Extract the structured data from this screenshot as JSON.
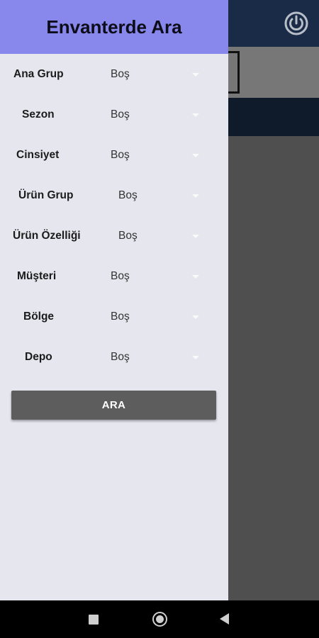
{
  "drawer": {
    "title": "Envanterde Ara",
    "filters": [
      {
        "label": "Ana Grup",
        "value": "Boş"
      },
      {
        "label": "Sezon",
        "value": "Boş"
      },
      {
        "label": "Cinsiyet",
        "value": "Boş"
      },
      {
        "label": "Ürün Grup",
        "value": "Boş"
      },
      {
        "label": "Ürün Özelliği",
        "value": "Boş"
      },
      {
        "label": "Müşteri",
        "value": "Boş"
      },
      {
        "label": "Bölge",
        "value": "Boş"
      },
      {
        "label": "Depo",
        "value": "Boş"
      }
    ],
    "search_button": "ARA"
  },
  "background": {
    "icons": [
      "power-icon"
    ]
  },
  "colors": {
    "drawer_header": "#8787ec",
    "drawer_body": "#e6e6ef",
    "button": "#5d5d5d",
    "topbar": "#1a2b47"
  },
  "navbar": {
    "icons": [
      "recent-apps-icon",
      "home-icon",
      "back-icon"
    ]
  }
}
